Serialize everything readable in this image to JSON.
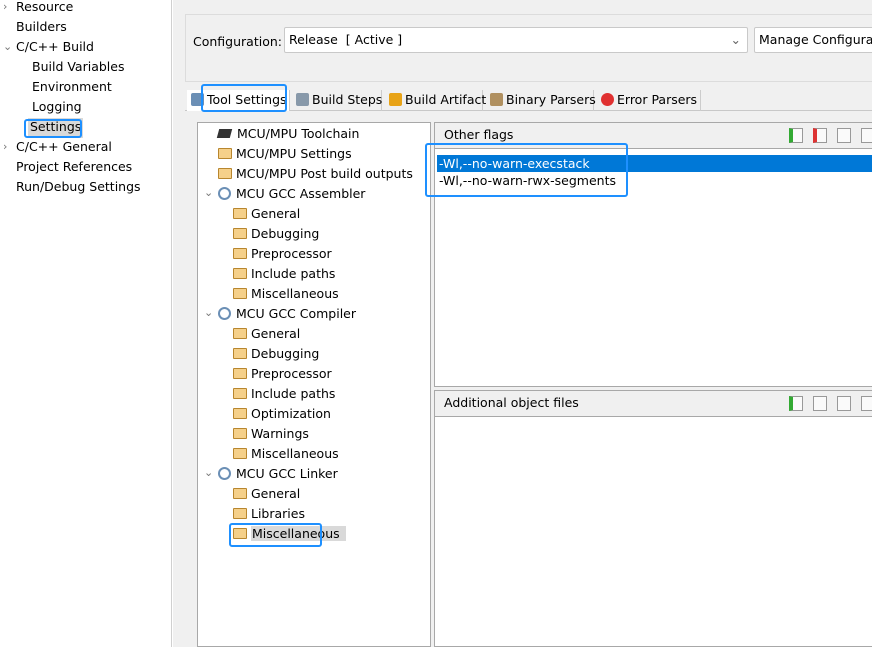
{
  "sidebar": {
    "items": [
      {
        "label": "Resource",
        "expander": "collapsed"
      },
      {
        "label": "Builders"
      },
      {
        "label": "C/C++ Build",
        "expander": "expanded"
      },
      {
        "label": "Build Variables"
      },
      {
        "label": "Environment"
      },
      {
        "label": "Logging"
      },
      {
        "label": "Settings",
        "selected": true
      },
      {
        "label": "C/C++ General",
        "expander": "collapsed"
      },
      {
        "label": "Project References"
      },
      {
        "label": "Run/Debug Settings"
      }
    ]
  },
  "config": {
    "label": "Configuration:",
    "value": "Release  [ Active ]",
    "manage_label": "Manage Configurat"
  },
  "tabs": [
    {
      "label": "Tool Settings",
      "icon": "tool-settings-icon",
      "active": true
    },
    {
      "label": "Build Steps",
      "icon": "build-steps-icon"
    },
    {
      "label": "Build Artifact",
      "icon": "trophy-icon"
    },
    {
      "label": "Binary Parsers",
      "icon": "binary-icon"
    },
    {
      "label": "Error Parsers",
      "icon": "error-icon"
    }
  ],
  "tree": [
    {
      "label": "MCU/MPU Toolchain",
      "icon": "chip-icon",
      "level": 0
    },
    {
      "label": "MCU/MPU Settings",
      "icon": "folder-icon",
      "level": 0
    },
    {
      "label": "MCU/MPU Post build outputs",
      "icon": "folder-icon",
      "level": 0
    },
    {
      "label": "MCU GCC Assembler",
      "icon": "gear-icon",
      "level": 0,
      "expanded": true
    },
    {
      "label": "General",
      "level": 1
    },
    {
      "label": "Debugging",
      "level": 1
    },
    {
      "label": "Preprocessor",
      "level": 1
    },
    {
      "label": "Include paths",
      "level": 1
    },
    {
      "label": "Miscellaneous",
      "level": 1
    },
    {
      "label": "MCU GCC Compiler",
      "icon": "gear-icon",
      "level": 0,
      "expanded": true
    },
    {
      "label": "General",
      "level": 1
    },
    {
      "label": "Debugging",
      "level": 1
    },
    {
      "label": "Preprocessor",
      "level": 1
    },
    {
      "label": "Include paths",
      "level": 1
    },
    {
      "label": "Optimization",
      "level": 1
    },
    {
      "label": "Warnings",
      "level": 1
    },
    {
      "label": "Miscellaneous",
      "level": 1
    },
    {
      "label": "MCU GCC Linker",
      "icon": "gear-icon",
      "level": 0,
      "expanded": true
    },
    {
      "label": "General",
      "level": 1
    },
    {
      "label": "Libraries",
      "level": 1
    },
    {
      "label": "Miscellaneous",
      "level": 1,
      "selected": true
    }
  ],
  "other_flags": {
    "title": "Other flags",
    "items": [
      "-Wl,--no-warn-execstack",
      "-Wl,--no-warn-rwx-segments"
    ],
    "selected_index": 0
  },
  "additional_objects": {
    "title": "Additional object files",
    "items": []
  },
  "colors": {
    "selection": "#0078d7",
    "highlight_box": "#1e90ff",
    "panel_bg": "#f0f0f0"
  }
}
